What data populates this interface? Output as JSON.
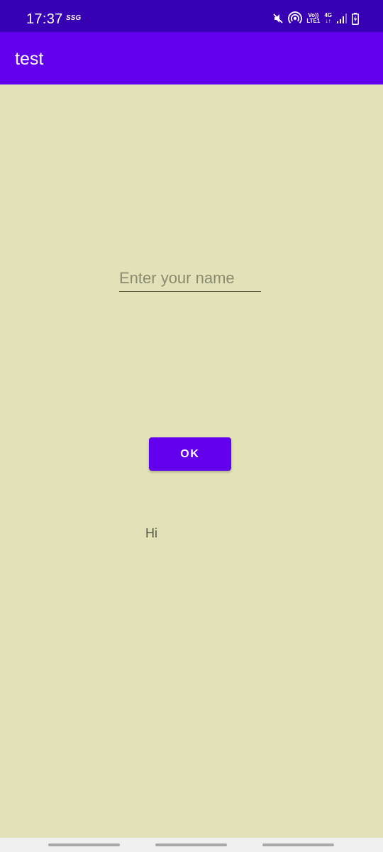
{
  "status_bar": {
    "time": "17:37",
    "carrier_tag": "SSG",
    "volte_label": "Vo))",
    "lte_label": "LTE1",
    "network_label": "4G",
    "data_arrows": "↓↑",
    "icons": [
      "mute-icon",
      "hotspot-icon",
      "signal-icon",
      "battery-charging-icon"
    ]
  },
  "app_bar": {
    "title": "test"
  },
  "form": {
    "name_placeholder": "Enter your name",
    "name_value": "",
    "ok_label": "OK"
  },
  "output": {
    "greeting": "Hi"
  },
  "colors": {
    "status_bar": "#3700b3",
    "app_bar": "#6200ee",
    "background": "#e1e2b8",
    "button": "#6200ee"
  }
}
